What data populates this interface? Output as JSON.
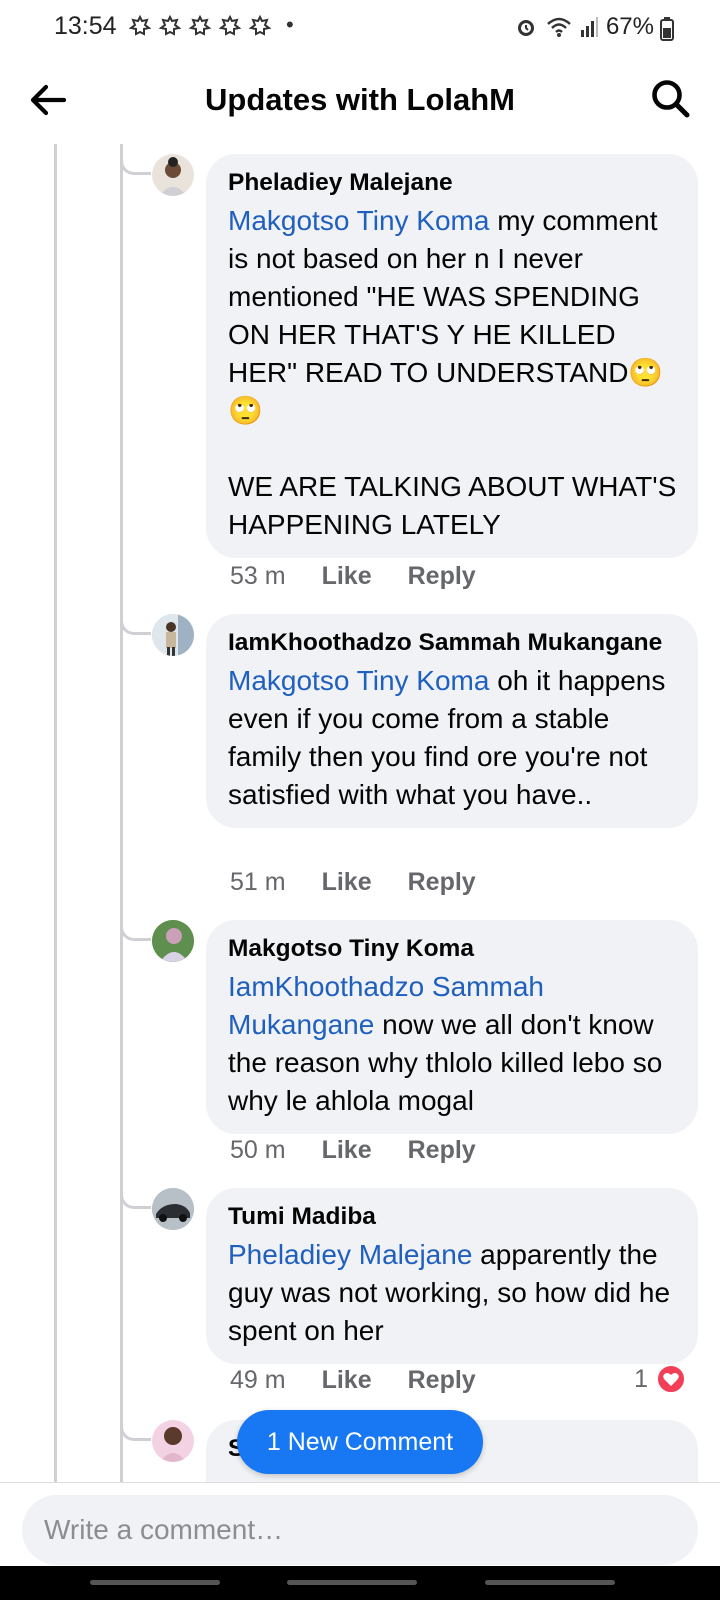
{
  "status_bar": {
    "time": "13:54",
    "dot": "•",
    "battery": "67%",
    "icons": [
      "notification-icon",
      "alarm-icon",
      "wifi-icon",
      "signal-icon",
      "battery-icon"
    ]
  },
  "header": {
    "title": "Updates with LolahM",
    "icons": [
      "back-arrow-icon",
      "search-icon"
    ]
  },
  "comments": [
    {
      "author": "Pheladiey Malejane",
      "mention": "Makgotso Tiny Koma",
      "text": " my comment is not based on her n I never mentioned \"HE WAS SPENDING ON HER THAT'S Y HE KILLED HER\" READ TO UNDERSTAND🙄🙄\n\nWE ARE TALKING ABOUT WHAT'S HAPPENING LATELY",
      "time": "53 m",
      "like": "Like",
      "reply": "Reply"
    },
    {
      "author": "IamKhoothadzo Sammah Mukangane",
      "mention": "Makgotso Tiny Koma",
      "text": " oh it happens even if you come from a stable family then you find ore you're not satisfied with what you have..",
      "time": "51 m",
      "like": "Like",
      "reply": "Reply"
    },
    {
      "author": "Makgotso Tiny Koma",
      "mention": "IamKhoothadzo Sammah Mukangane",
      "text": " now we all don't know the reason why thlolo killed lebo so why le ahlola mogal",
      "time": "50 m",
      "like": "Like",
      "reply": "Reply"
    },
    {
      "author": "Tumi Madiba",
      "mention": "Pheladiey Malejane",
      "text": " apparently the guy was not working, so how did he spent on her",
      "time": "49 m",
      "like": "Like",
      "reply": "Reply",
      "reaction_count": "1",
      "reaction_icon": "heart-reaction-icon"
    },
    {
      "author": "Sammy Sams"
    }
  ],
  "new_comment_button": "1 New Comment",
  "composer": {
    "placeholder": "Write a comment…"
  },
  "colors": {
    "mention": "#1f5fbf",
    "bubble": "#f0f2f5",
    "accent": "#1877f2",
    "heart": "#f33e58"
  }
}
